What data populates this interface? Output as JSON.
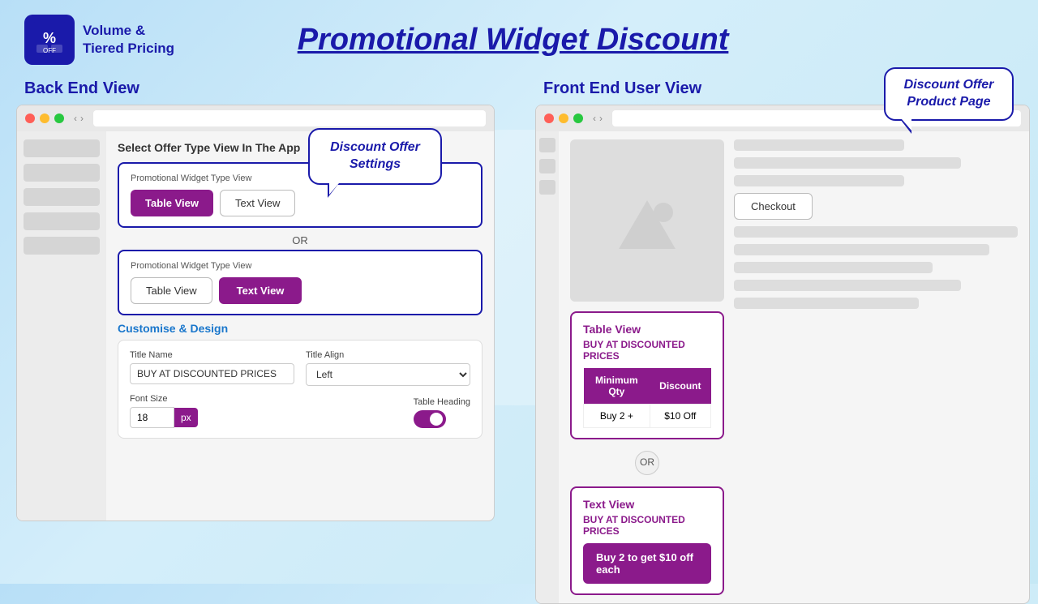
{
  "header": {
    "logo_line1": "Volume &",
    "logo_line2": "Tiered Pricing",
    "page_title": "Promotional Widget Discount"
  },
  "left_section": {
    "label": "Back End View",
    "select_offer_heading": "Select Offer Type View In The App",
    "speech_bubble": {
      "line1": "Discount Offer",
      "line2": "Settings"
    },
    "card1": {
      "label": "Promotional Widget Type View",
      "btn_table": "Table View",
      "btn_text": "Text View"
    },
    "or_text": "OR",
    "card2": {
      "label": "Promotional Widget Type View",
      "btn_table": "Table View",
      "btn_text": "Text View"
    },
    "customise_heading": "Customise & Design",
    "form": {
      "title_name_label": "Title Name",
      "title_name_value": "BUY AT DISCOUNTED PRICES",
      "title_align_label": "Title Align",
      "title_align_value": "Left",
      "font_size_label": "Font Size",
      "font_size_value": "18",
      "px_label": "px",
      "table_heading_label": "Table Heading"
    }
  },
  "right_section": {
    "label": "Front End User View",
    "speech_bubble": {
      "line1": "Discount Offer",
      "line2": "Product Page"
    },
    "checkout_btn": "Checkout",
    "table_view": {
      "title": "Table View",
      "subtitle": "BUY AT DISCOUNTED PRICES",
      "col1": "Minimum Qty",
      "col2": "Discount",
      "row1_col1": "Buy 2 +",
      "row1_col2": "$10 Off"
    },
    "or_text": "OR",
    "text_view": {
      "title": "Text View",
      "subtitle": "BUY AT DISCOUNTED PRICES",
      "offer_text": "Buy 2 to get $10 off each"
    }
  }
}
